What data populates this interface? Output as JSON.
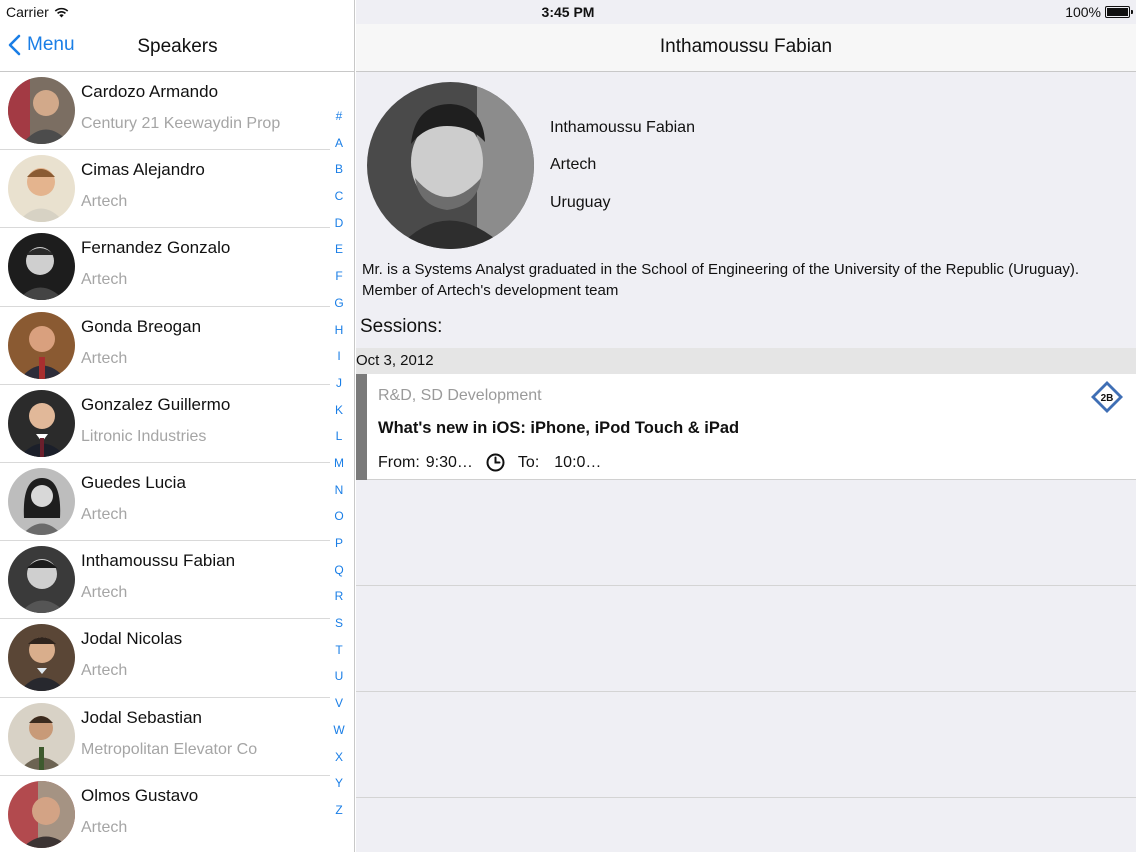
{
  "status_bar": {
    "carrier": "Carrier",
    "time": "3:45 PM",
    "battery": "100%"
  },
  "master": {
    "back_label": "Menu",
    "title": "Speakers",
    "speakers": [
      {
        "name": "Cardozo Armando",
        "company": "Century 21 Keewaydin Prop"
      },
      {
        "name": "Cimas Alejandro",
        "company": "Artech"
      },
      {
        "name": "Fernandez Gonzalo",
        "company": "Artech"
      },
      {
        "name": "Gonda Breogan",
        "company": "Artech"
      },
      {
        "name": "Gonzalez Guillermo",
        "company": "Litronic Industries"
      },
      {
        "name": "Guedes Lucia",
        "company": "Artech"
      },
      {
        "name": "Inthamoussu Fabian",
        "company": "Artech"
      },
      {
        "name": "Jodal Nicolas",
        "company": "Artech"
      },
      {
        "name": "Jodal Sebastian",
        "company": "Metropolitan Elevator Co"
      },
      {
        "name": "Olmos Gustavo",
        "company": "Artech"
      }
    ],
    "index": [
      "#",
      "A",
      "B",
      "C",
      "D",
      "E",
      "F",
      "G",
      "H",
      "I",
      "J",
      "K",
      "L",
      "M",
      "N",
      "O",
      "P",
      "Q",
      "R",
      "S",
      "T",
      "U",
      "V",
      "W",
      "X",
      "Y",
      "Z"
    ]
  },
  "detail": {
    "title": "Inthamoussu Fabian",
    "name": "Inthamoussu Fabian",
    "company": "Artech",
    "country": "Uruguay",
    "bio": "Mr. is a Systems Analyst graduated in the School of Engineering of the University of the Republic (Uruguay). Member of Artech's development team",
    "sessions_title": "Sessions:",
    "date": "Oct 3, 2012",
    "session": {
      "track": "R&D, SD Development",
      "title": "What's new in iOS: iPhone, iPod Touch & iPad",
      "from_label": "From:",
      "from_value": "9:30…",
      "to_label": "To:",
      "to_value": "10:0…",
      "room": "2B"
    }
  },
  "colors": {
    "accent": "#1a7ee6",
    "session_bar": "#7a7a7a"
  }
}
